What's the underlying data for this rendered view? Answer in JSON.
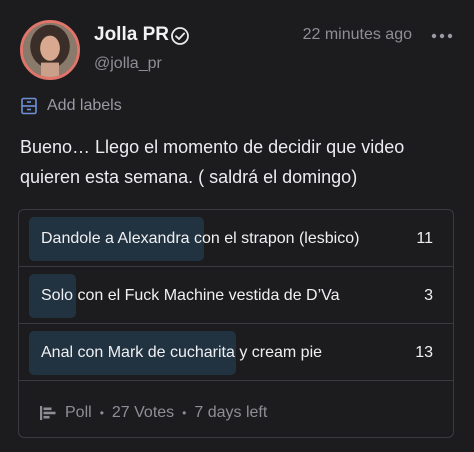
{
  "post": {
    "author_name": "Jolla PR",
    "handle": "@jolla_pr",
    "time": "22 minutes ago",
    "add_labels": "Add labels",
    "text": "Bueno… Llego el momento de decidir que video quieren esta semana. ( saldrá el domingo)"
  },
  "poll": {
    "options": [
      {
        "label": "Dandole a Alexandra con el strapon (lesbico)",
        "votes": "11",
        "share": 0.41
      },
      {
        "label": "Solo con el Fuck Machine vestida de D’Va",
        "votes": "3",
        "share": 0.11
      },
      {
        "label": "Anal con Mark de cucharita y cream pie",
        "votes": "13",
        "share": 0.48
      }
    ],
    "footer": {
      "type": "Poll",
      "votes": "27 Votes",
      "time_left": "7 days left"
    }
  },
  "icons": {
    "verified": "verified-icon",
    "more": "more-icon",
    "labels": "label-icon",
    "poll": "poll-icon"
  },
  "colors": {
    "background": "#1c1c1f",
    "avatar_ring": "#e0756a",
    "poll_bar": "#213240",
    "muted_text": "#8e8e96"
  }
}
